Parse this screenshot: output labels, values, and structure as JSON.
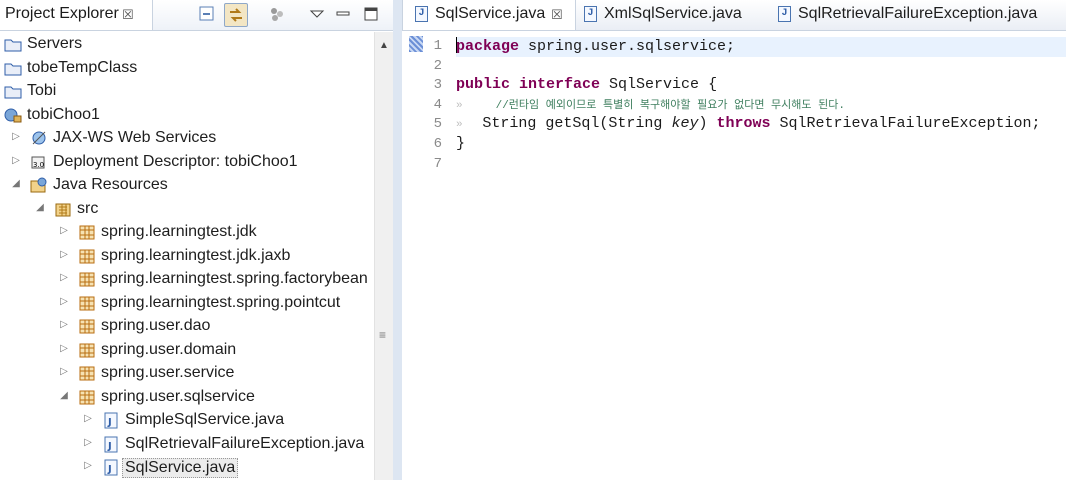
{
  "explorer": {
    "title": "Project Explorer",
    "close_glyph": "☒",
    "toolbar": [
      {
        "icon": "collapse-all-icon"
      },
      {
        "icon": "link-with-editor-icon"
      },
      {
        "icon": "focus-icon"
      },
      {
        "icon": "view-menu-icon"
      },
      {
        "icon": "minimize-icon"
      },
      {
        "icon": "maximize-icon"
      }
    ],
    "tree": [
      {
        "label": "Servers",
        "icon": "folder-icon",
        "depth": 0,
        "twisty": ""
      },
      {
        "label": "tobeTempClass",
        "icon": "folder-icon",
        "depth": 0,
        "twisty": ""
      },
      {
        "label": "Tobi",
        "icon": "folder-icon",
        "depth": 0,
        "twisty": ""
      },
      {
        "label": "tobiChoo1",
        "icon": "web-project-icon",
        "depth": 0,
        "twisty": ""
      },
      {
        "label": "JAX-WS Web Services",
        "icon": "webservices-icon",
        "depth": 1,
        "twisty": "▷"
      },
      {
        "label": "Deployment Descriptor: tobiChoo1",
        "icon": "deployment-descriptor-icon",
        "depth": 1,
        "twisty": "▷"
      },
      {
        "label": "Java Resources",
        "icon": "java-resources-icon",
        "depth": 1,
        "twisty": "◢"
      },
      {
        "label": "src",
        "icon": "source-folder-icon",
        "depth": 2,
        "twisty": "◢"
      },
      {
        "label": "spring.learningtest.jdk",
        "icon": "package-icon",
        "depth": 3,
        "twisty": "▷"
      },
      {
        "label": "spring.learningtest.jdk.jaxb",
        "icon": "package-icon",
        "depth": 3,
        "twisty": "▷"
      },
      {
        "label": "spring.learningtest.spring.factorybean",
        "icon": "package-icon",
        "depth": 3,
        "twisty": "▷"
      },
      {
        "label": "spring.learningtest.spring.pointcut",
        "icon": "package-icon",
        "depth": 3,
        "twisty": "▷"
      },
      {
        "label": "spring.user.dao",
        "icon": "package-icon",
        "depth": 3,
        "twisty": "▷"
      },
      {
        "label": "spring.user.domain",
        "icon": "package-icon",
        "depth": 3,
        "twisty": "▷"
      },
      {
        "label": "spring.user.service",
        "icon": "package-icon",
        "depth": 3,
        "twisty": "▷"
      },
      {
        "label": "spring.user.sqlservice",
        "icon": "package-icon",
        "depth": 3,
        "twisty": "◢"
      },
      {
        "label": "SimpleSqlService.java",
        "icon": "java-file-icon",
        "depth": 4,
        "twisty": "▷"
      },
      {
        "label": "SqlRetrievalFailureException.java",
        "icon": "java-file-icon",
        "depth": 4,
        "twisty": "▷"
      },
      {
        "label": "SqlService.java",
        "icon": "java-file-icon",
        "depth": 4,
        "twisty": "▷",
        "selected": true
      }
    ],
    "scrollbar": {
      "up_glyph": "▲",
      "grip_glyph": "≡"
    }
  },
  "editor": {
    "tabs": [
      {
        "label": "SqlService.java",
        "active": true,
        "close_glyph": "☒"
      },
      {
        "label": "XmlSqlService.java",
        "active": false
      },
      {
        "label": "SqlRetrievalFailureException.java",
        "active": false
      }
    ],
    "lines": [
      {
        "num": "1",
        "segments": [
          {
            "t": "package",
            "c": "kw"
          },
          {
            "t": " spring.user.sqlservice;",
            "c": ""
          }
        ]
      },
      {
        "num": "2",
        "segments": []
      },
      {
        "num": "3",
        "segments": [
          {
            "t": "public",
            "c": "kw"
          },
          {
            "t": " ",
            "c": ""
          },
          {
            "t": "interface",
            "c": "kw"
          },
          {
            "t": " SqlService {",
            "c": ""
          }
        ]
      },
      {
        "num": "4",
        "segments": [
          {
            "t": "»   ",
            "c": "ws"
          },
          {
            "t": "  //런타임 예외이므로 특별히 복구해야할 필요가 없다면 무시해도 된다.",
            "c": "cm"
          }
        ]
      },
      {
        "num": "5",
        "segments": [
          {
            "t": "»   ",
            "c": "ws"
          },
          {
            "t": "String getSql(String ",
            "c": ""
          },
          {
            "t": "key",
            "c": "it"
          },
          {
            "t": ") ",
            "c": ""
          },
          {
            "t": "throws",
            "c": "kw"
          },
          {
            "t": " SqlRetrievalFailureException;",
            "c": ""
          }
        ]
      },
      {
        "num": "6",
        "segments": [
          {
            "t": "}",
            "c": ""
          }
        ]
      },
      {
        "num": "7",
        "segments": []
      }
    ]
  },
  "colors": {
    "keyword": "#7f0055",
    "comment": "#3f7f5f",
    "current_line": "#e8f2fe",
    "package_icon": "#c47a1b",
    "java_icon": "#4a74b0"
  }
}
